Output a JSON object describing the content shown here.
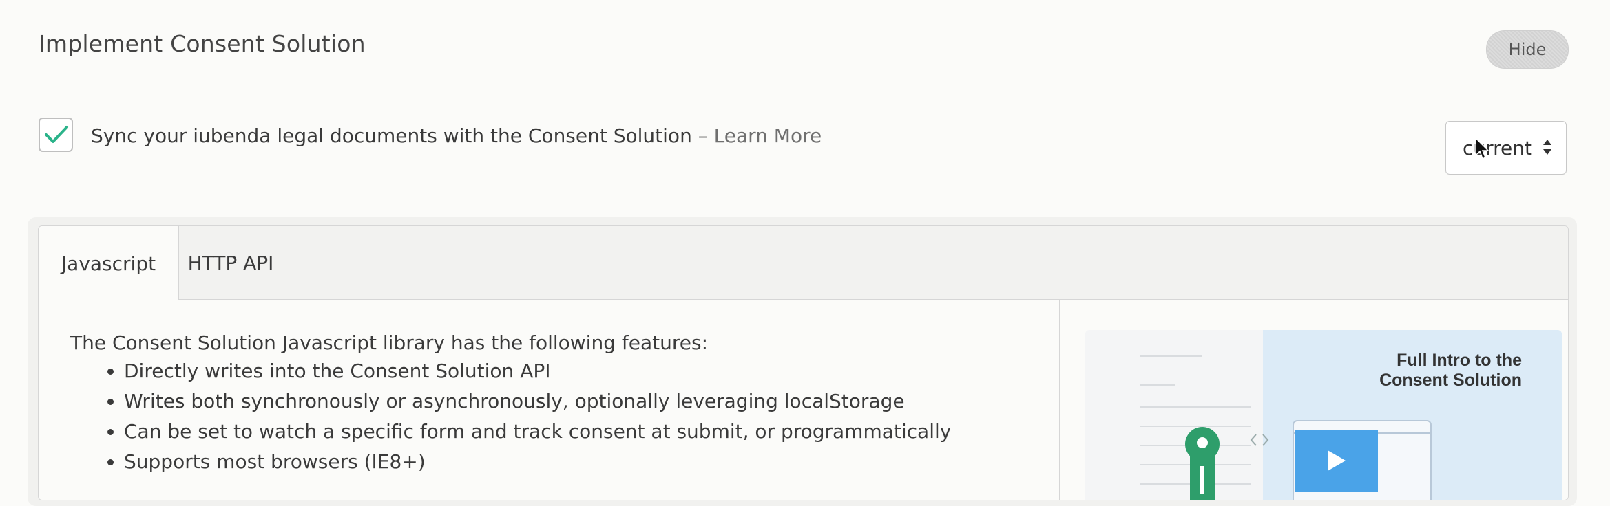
{
  "header": {
    "title": "Implement Consent Solution",
    "hide_label": "Hide"
  },
  "sync": {
    "checked": true,
    "text": "Sync your iubenda legal documents with the Consent Solution",
    "separator": "–",
    "learn_more": "Learn More"
  },
  "version_select": {
    "selected": "current"
  },
  "tabs": [
    {
      "label": "Javascript",
      "active": true
    },
    {
      "label": "HTTP API",
      "active": false
    }
  ],
  "content": {
    "intro": "The Consent Solution Javascript library has the following features:",
    "features": [
      "Directly writes into the Consent Solution API",
      "Writes both synchronously or asynchronously, optionally leveraging localStorage",
      "Can be set to watch a specific form and track consent at submit, or programmatically",
      "Supports most browsers (IE8+)"
    ]
  },
  "video": {
    "title_line1": "Full Intro to the",
    "title_line2": "Consent Solution",
    "play_icon": "play-icon"
  },
  "colors": {
    "check": "#2bb38a",
    "play": "#4aa3e8",
    "video_bg": "#dcebf7",
    "mascot": "#2e9e6b"
  }
}
